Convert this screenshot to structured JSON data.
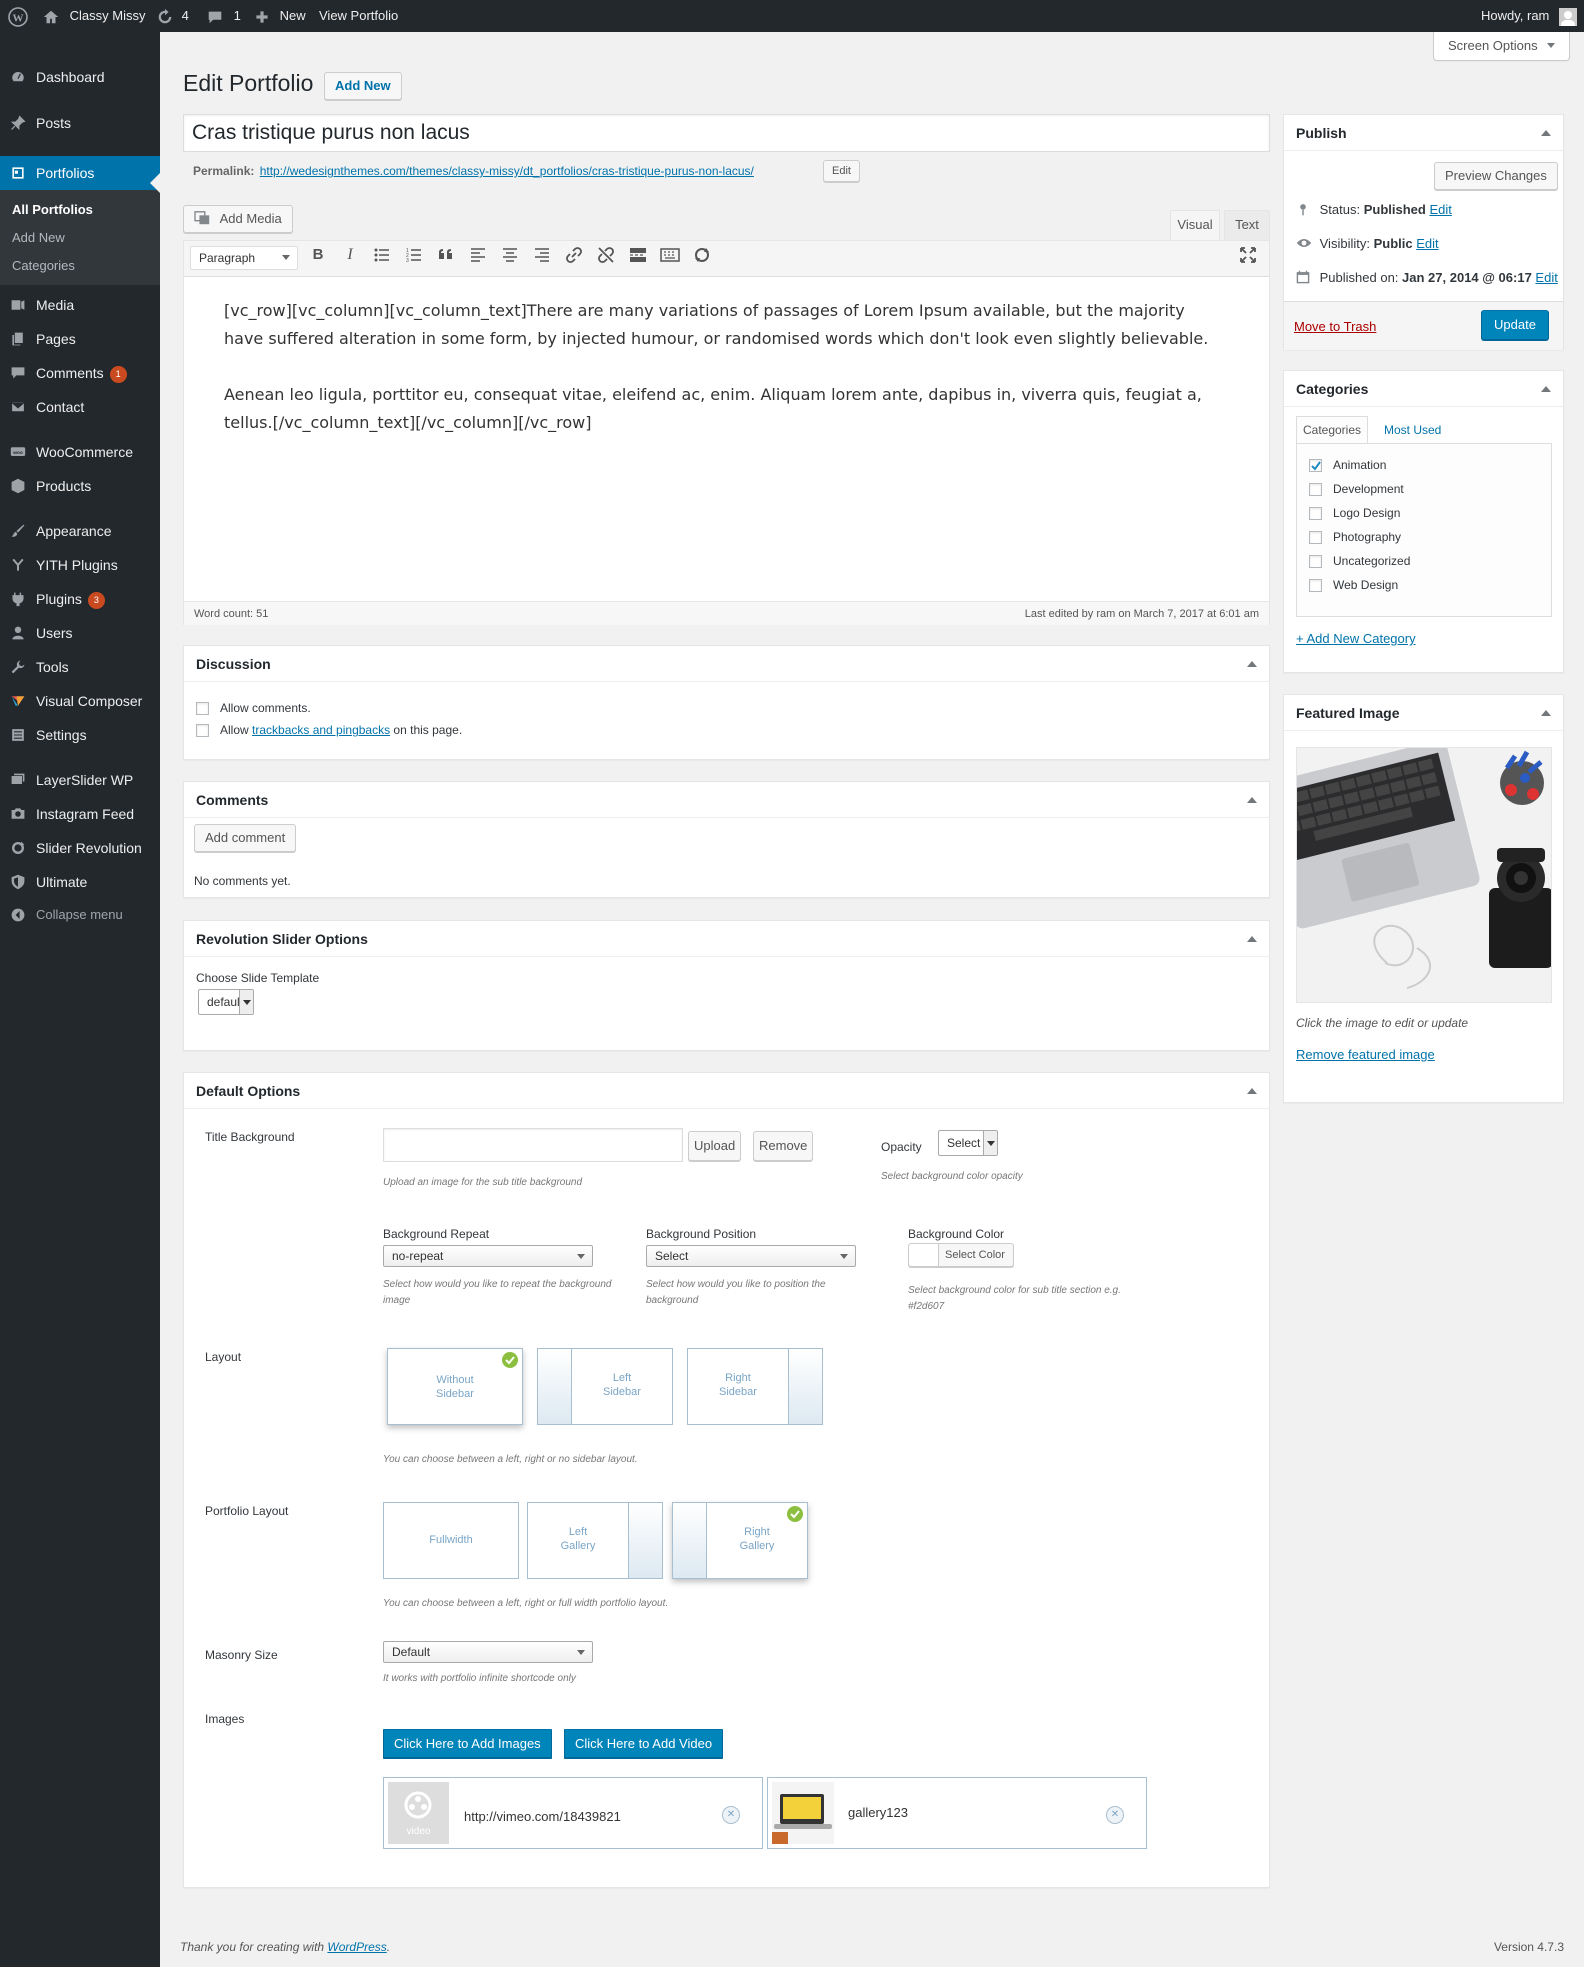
{
  "admin_bar": {
    "site_name": "Classy Missy",
    "updates_count": "4",
    "comments_count": "1",
    "new_label": "New",
    "view_label": "View Portfolio",
    "howdy": "Howdy, ram"
  },
  "sidebar": {
    "dashboard": "Dashboard",
    "posts": "Posts",
    "portfolios": "Portfolios",
    "sub_all": "All Portfolios",
    "sub_add": "Add New",
    "sub_categories": "Categories",
    "media": "Media",
    "pages": "Pages",
    "comments": "Comments",
    "comments_badge": "1",
    "contact": "Contact",
    "woocommerce": "WooCommerce",
    "products": "Products",
    "appearance": "Appearance",
    "yith": "YITH Plugins",
    "plugins": "Plugins",
    "plugins_badge": "3",
    "users": "Users",
    "tools": "Tools",
    "visual_composer": "Visual Composer",
    "settings": "Settings",
    "layerslider": "LayerSlider WP",
    "instagram": "Instagram Feed",
    "slider_revolution": "Slider Revolution",
    "ultimate": "Ultimate",
    "collapse": "Collapse menu"
  },
  "header": {
    "screen_options": "Screen Options",
    "page_title": "Edit Portfolio",
    "add_new": "Add New"
  },
  "post": {
    "title": "Cras tristique purus non lacus",
    "permalink_label": "Permalink:",
    "permalink_url": "http://wedesignthemes.com/themes/classy-missy/dt_portfolios/cras-tristique-purus-non-lacus/",
    "permalink_edit": "Edit"
  },
  "editor": {
    "add_media": "Add Media",
    "tab_visual": "Visual",
    "tab_text": "Text",
    "format_select": "Paragraph",
    "paragraph1": "[vc_row][vc_column][vc_column_text]There are many variations of passages of Lorem Ipsum available, but the majority have suffered alteration in some form, by injected humour, or randomised words which don't look even slightly believable.",
    "paragraph2": "Aenean leo ligula, porttitor eu, consequat vitae, eleifend ac, enim. Aliquam lorem ante, dapibus in, viverra quis, feugiat a, tellus.[/vc_column_text][/vc_column][/vc_row]",
    "word_count": "Word count: 51",
    "last_edited": "Last edited by ram on March 7, 2017 at 6:01 am"
  },
  "discussion": {
    "title": "Discussion",
    "allow_comments": "Allow comments.",
    "allow_prefix": "Allow ",
    "trackbacks_link": "trackbacks and pingbacks",
    "allow_suffix": " on this page."
  },
  "comments_box": {
    "title": "Comments",
    "add_comment": "Add comment",
    "no_comments": "No comments yet."
  },
  "revslider": {
    "title": "Revolution Slider Options",
    "choose_label": "Choose Slide Template",
    "template_value": "default"
  },
  "default_options": {
    "title": "Default Options",
    "title_background_label": "Title Background",
    "upload": "Upload",
    "remove": "Remove",
    "upload_hint": "Upload an image for the sub title background",
    "opacity_label": "Opacity",
    "opacity_value": "Select",
    "opacity_hint": "Select background color opacity",
    "bg_repeat_label": "Background Repeat",
    "bg_repeat_value": "no-repeat",
    "bg_repeat_hint": "Select how would you like to repeat the background image",
    "bg_position_label": "Background Position",
    "bg_position_value": "Select",
    "bg_position_hint": "Select how would you like to position the background",
    "bg_color_label": "Background Color",
    "bg_color_button": "Select Color",
    "bg_color_hint": "Select background color for sub title section e.g. #f2d607",
    "layout_label": "Layout",
    "layout_options": [
      {
        "line1": "Without",
        "line2": "Sidebar"
      },
      {
        "line1": "Left",
        "line2": "Sidebar"
      },
      {
        "line1": "Right",
        "line2": "Sidebar"
      }
    ],
    "layout_hint": "You can choose between a left, right or no sidebar layout.",
    "portfolio_layout_label": "Portfolio Layout",
    "portfolio_layout_options": [
      {
        "line1": "Fullwidth",
        "line2": ""
      },
      {
        "line1": "Left",
        "line2": "Gallery"
      },
      {
        "line1": "Right",
        "line2": "Gallery"
      }
    ],
    "portfolio_layout_hint": "You can choose between a left, right or full width portfolio layout.",
    "masonry_label": "Masonry Size",
    "masonry_value": "Default",
    "masonry_hint": "It works with portfolio infinite shortcode only",
    "images_label": "Images",
    "add_images": "Click Here to Add Images",
    "add_video": "Click Here to Add Video",
    "item1_url": "http://vimeo.com/18439821",
    "item1_thumb_label": "video",
    "item2_name": "gallery123"
  },
  "publish": {
    "title": "Publish",
    "preview": "Preview Changes",
    "status_label": "Status: ",
    "status_value": "Published",
    "visibility_label": "Visibility: ",
    "visibility_value": "Public",
    "published_label": "Published on: ",
    "published_value": "Jan 27, 2014 @ 06:17",
    "edit": "Edit",
    "trash": "Move to Trash",
    "update": "Update"
  },
  "categories": {
    "title": "Categories",
    "tab_all": "Categories",
    "tab_used": "Most Used",
    "items": [
      "Animation",
      "Development",
      "Logo Design",
      "Photography",
      "Uncategorized",
      "Web Design"
    ],
    "add_new": "+ Add New Category"
  },
  "featured": {
    "title": "Featured Image",
    "hint": "Click the image to edit or update",
    "remove": "Remove featured image"
  },
  "footer": {
    "thanks_prefix": "Thank you for creating with ",
    "wordpress": "WordPress",
    "thanks_suffix": ".",
    "version": "Version 4.7.3"
  },
  "colors": {
    "admin_dark": "#23282d",
    "accent": "#0073aa",
    "primary_button": "#0085ba",
    "badge": "#ca4a1f",
    "trash": "#a00",
    "selected_check": "#8cbf3f"
  }
}
